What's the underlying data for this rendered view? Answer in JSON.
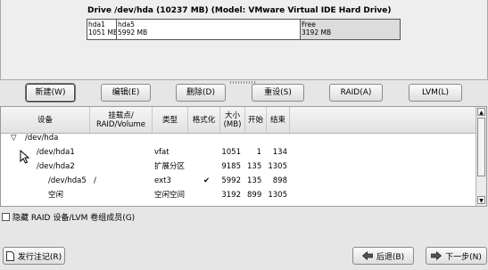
{
  "drive": {
    "title": "Drive /dev/hda (10237 MB) (Model: VMware Virtual IDE Hard Drive)",
    "segments": [
      {
        "name": "hda1",
        "size": "1051 MB"
      },
      {
        "name": "hda5",
        "size": "5992 MB"
      },
      {
        "name": "Free",
        "size": "3192 MB"
      }
    ]
  },
  "toolbar": {
    "new": "新建(W)",
    "edit": "编辑(E)",
    "delete": "删除(D)",
    "reset": "重设(S)",
    "raid": "RAID(A)",
    "lvm": "LVM(L)"
  },
  "table": {
    "headers": {
      "device": "设备",
      "mount": "挂载点/\nRAID/Volume",
      "type": "类型",
      "format": "格式化",
      "size": "大小\n(MB)",
      "start": "开始",
      "end": "结束"
    },
    "rows": [
      {
        "device": "/dev/hda",
        "mount": "",
        "type": "",
        "format": "",
        "size": "",
        "start": "",
        "end": ""
      },
      {
        "device": "/dev/hda1",
        "mount": "",
        "type": "vfat",
        "format": "",
        "size": "1051",
        "start": "1",
        "end": "134"
      },
      {
        "device": "/dev/hda2",
        "mount": "",
        "type": "扩展分区",
        "format": "",
        "size": "9185",
        "start": "135",
        "end": "1305"
      },
      {
        "device": "/dev/hda5",
        "mount": "/",
        "type": "ext3",
        "format": "✔",
        "size": "5992",
        "start": "135",
        "end": "898"
      },
      {
        "device": "空闲",
        "mount": "",
        "type": "空闲空间",
        "format": "",
        "size": "3192",
        "start": "899",
        "end": "1305"
      }
    ]
  },
  "hide_raid": {
    "label": "隐藏 RAID 设备/LVM 卷组成员(G)",
    "checked": false
  },
  "bottom": {
    "release_notes": "发行注记(R)",
    "back": "后退(B)",
    "next": "下一步(N)"
  }
}
